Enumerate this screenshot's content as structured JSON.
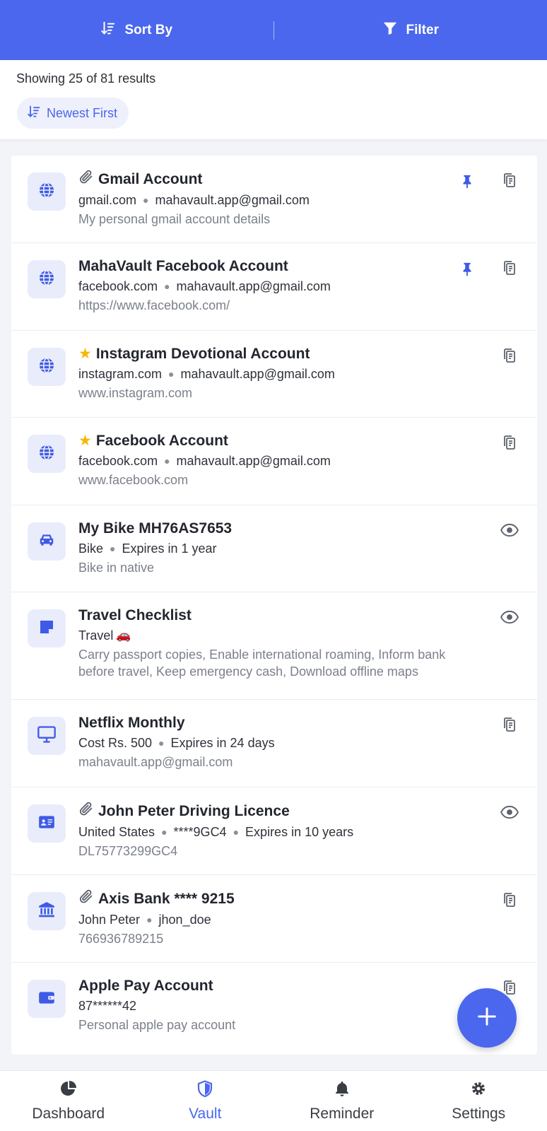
{
  "topbar": {
    "sort_label": "Sort By",
    "filter_label": "Filter"
  },
  "summary": {
    "count_text": "Showing 25 of 81 results",
    "sort_chip": "Newest First"
  },
  "items": [
    {
      "title": "Gmail Account",
      "badge_icon": "globe-icon",
      "attach": true,
      "star": false,
      "pinned": true,
      "action": "copy-icon",
      "meta": [
        "gmail.com",
        "mahavault.app@gmail.com"
      ],
      "desc": "My personal gmail account details"
    },
    {
      "title": "MahaVault Facebook Account",
      "badge_icon": "globe-icon",
      "attach": false,
      "star": false,
      "pinned": true,
      "action": "copy-icon",
      "meta": [
        "facebook.com",
        "mahavault.app@gmail.com"
      ],
      "desc": "https://www.facebook.com/"
    },
    {
      "title": "Instagram Devotional Account",
      "badge_icon": "globe-icon",
      "attach": false,
      "star": true,
      "pinned": false,
      "action": "copy-icon",
      "meta": [
        "instagram.com",
        "mahavault.app@gmail.com"
      ],
      "desc": "www.instagram.com"
    },
    {
      "title": "Facebook Account",
      "badge_icon": "globe-icon",
      "attach": false,
      "star": true,
      "pinned": false,
      "action": "copy-icon",
      "meta": [
        "facebook.com",
        "mahavault.app@gmail.com"
      ],
      "desc": "www.facebook.com"
    },
    {
      "title": "My Bike MH76AS7653",
      "badge_icon": "car-icon",
      "attach": false,
      "star": false,
      "pinned": false,
      "action": "eye-icon",
      "meta": [
        "Bike",
        "Expires in 1 year"
      ],
      "desc": "Bike in native"
    },
    {
      "title": "Travel Checklist",
      "badge_icon": "note-icon",
      "attach": false,
      "star": false,
      "pinned": false,
      "action": "eye-icon",
      "meta": [
        "Travel"
      ],
      "meta_emoji": "🚗",
      "desc": "Carry passport copies, Enable international roaming, Inform bank before travel, Keep emergency cash, Download offline maps"
    },
    {
      "title": "Netflix Monthly",
      "badge_icon": "monitor-icon",
      "attach": false,
      "star": false,
      "pinned": false,
      "action": "copy-icon",
      "meta": [
        "Cost Rs. 500",
        "Expires in 24 days"
      ],
      "desc": "mahavault.app@gmail.com"
    },
    {
      "title": "John Peter Driving Licence",
      "badge_icon": "id-card-icon",
      "attach": true,
      "star": false,
      "pinned": false,
      "action": "eye-icon",
      "meta": [
        "United States",
        "****9GC4",
        "Expires in 10 years"
      ],
      "desc": "DL75773299GC4"
    },
    {
      "title": "Axis Bank **** 9215",
      "badge_icon": "bank-icon",
      "attach": true,
      "star": false,
      "pinned": false,
      "action": "copy-icon",
      "meta": [
        "John Peter",
        "jhon_doe"
      ],
      "desc": "766936789215"
    },
    {
      "title": "Apple Pay Account",
      "badge_icon": "wallet-icon",
      "attach": false,
      "star": false,
      "pinned": false,
      "action": "copy-icon",
      "meta": [
        "87******42"
      ],
      "desc": "Personal apple pay account"
    }
  ],
  "nav": [
    {
      "label": "Dashboard",
      "icon": "pie-chart-icon",
      "active": false
    },
    {
      "label": "Vault",
      "icon": "shield-icon",
      "active": true
    },
    {
      "label": "Reminder",
      "icon": "bell-icon",
      "active": false
    },
    {
      "label": "Settings",
      "icon": "gear-icon",
      "active": false
    }
  ],
  "colors": {
    "brand": "#4a67ee",
    "star": "#f5b800",
    "muted": "#7b808b"
  }
}
